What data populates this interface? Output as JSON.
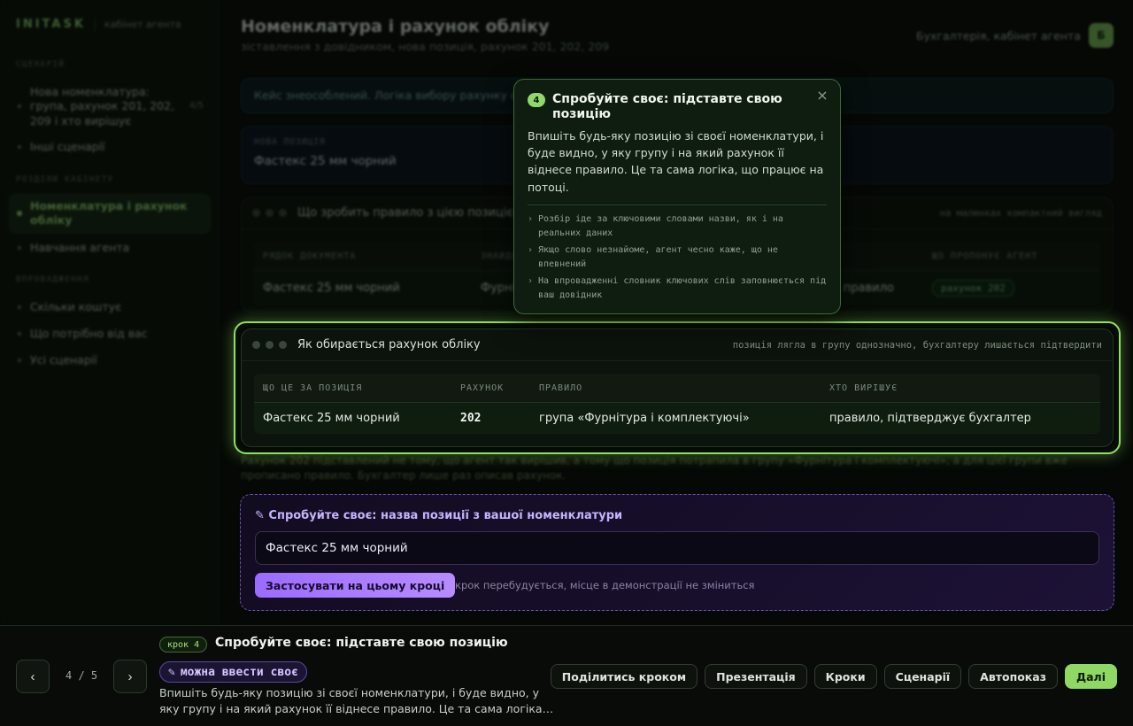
{
  "colors": {
    "accent": "#8fd864",
    "focus_ring": "#8fe05f",
    "try_accent": "#9b6bff",
    "bg": "#050805"
  },
  "sidebar": {
    "logo": "INITASK",
    "subtitle": "кабінет агента",
    "sections": {
      "scenario": "СЦЕНАРІЙ",
      "sections_of_cabinet": "РОЗДІЛИ КАБІНЕТУ",
      "implementation": "ВПРОВАДЖЕННЯ"
    },
    "scenario_items": [
      {
        "label": "Нова номенклатура: група, рахунок 201, 202, 209 і хто вирішує",
        "count": "4/5"
      },
      {
        "label": "Інші сценарії"
      }
    ],
    "section_items": [
      {
        "label": "Номенклатура і рахунок обліку"
      },
      {
        "label": "Навчання агента"
      }
    ],
    "impl_items": [
      {
        "label": "Скільки коштує"
      },
      {
        "label": "Що потрібно від вас"
      },
      {
        "label": "Усі сценарії"
      }
    ]
  },
  "header": {
    "title": "Номенклатура і рахунок обліку",
    "subtitle": "зіставлення з довідником, нова позиція, рахунок 201, 202, 209",
    "context": "Бухгалтерія, кабінет агента",
    "avatar": "Б"
  },
  "case_note": "Кейс знеособлений. Логіка вибору рахунку саме та, що працює на потоці.",
  "new_position": {
    "label": "НОВА ПОЗИЦІЯ",
    "value": "Фастекс 25 мм чорний"
  },
  "rule_card": {
    "title": "Що зробить правило з цією позицією",
    "note": "на малюнках компактний вигляд",
    "columns": [
      "РЯДОК ДОКУМЕНТА",
      "ЗНАЙДЕНО В ДОВІДНИКУ",
      "ЩО ПРОПОНУЄ АГЕНТ"
    ],
    "row": {
      "line": "Фастекс 25 мм чорний",
      "found": "Фурнітура і комплектуючі, рівень збігу високий, довідник і правило",
      "proposal": "рахунок 202"
    }
  },
  "account_card": {
    "title": "Як обирається рахунок обліку",
    "note": "позиція лягла в групу однозначно, бухгалтеру лишається підтвердити",
    "columns": [
      "ЩО ЦЕ ЗА ПОЗИЦІЯ",
      "РАХУНОК",
      "ПРАВИЛО",
      "ХТО ВИРІШУЄ"
    ],
    "row": {
      "position": "Фастекс 25 мм чорний",
      "account": "202",
      "rule": "група «Фурнітура і комплектуючі»",
      "decider": "правило, підтверджує бухгалтер"
    }
  },
  "under_note": "Рахунок 202 підставлений не тому, що агент так вирішив, а тому що позиція потрапила в групу «Фурнітура і комплектуючі», а для цієї групи вже прописано правило. Бухгалтер лише раз описав рахунок.",
  "try": {
    "title": "✎ Спробуйте своє: назва позиції з вашої номенклатури",
    "input_value": "Фастекс 25 мм чорний",
    "apply_label": "Застосувати на цьому кроці",
    "hint": "крок перебудується, місце в демонстрації не зміниться"
  },
  "popover": {
    "step_num": "4",
    "title": "Спробуйте своє: підставте свою позицію",
    "close": "×",
    "text": "Впишіть будь-яку позицію зі своєї номенклатури, і буде видно, у яку групу і на який рахунок її віднесе правило. Це та сама логіка, що працює на потоці.",
    "bullets": [
      "Розбір іде за ключовими словами назви, як і на реальних даних",
      "Якщо слово незнайоме, агент чесно каже, що не впевнений",
      "На впровадженні словник ключових слів заповнюється під ваш довідник"
    ]
  },
  "bottom": {
    "prev": "‹",
    "next": "›",
    "counter": "4 / 5",
    "step_chip": "крок 4",
    "step_title": "Спробуйте своє: підставте свою позицію",
    "can_badge": "можна ввести своє",
    "can_icon": "✎",
    "desc": "Впишіть будь-яку позицію зі своєї номенклатури, і буде видно, у яку групу і на який рахунок її віднесе правило. Це та сама логіка…",
    "actions": [
      "Поділитись кроком",
      "Презентація",
      "Кроки",
      "Сценарії",
      "Автопоказ"
    ],
    "next_label": "Далі"
  }
}
